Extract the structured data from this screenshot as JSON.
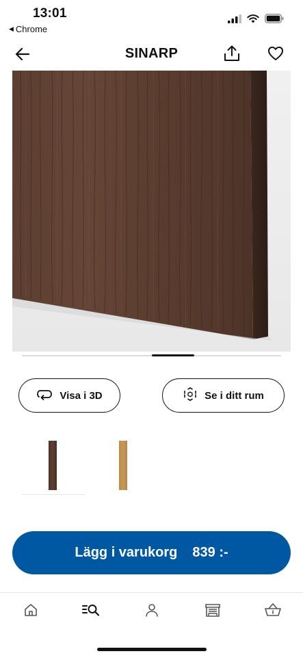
{
  "status_bar": {
    "time": "13:01",
    "back_app": "Chrome",
    "icons": [
      "signal-icon",
      "wifi-icon",
      "battery-icon"
    ]
  },
  "nav": {
    "title": "SINARP",
    "icons": [
      "back-arrow-icon",
      "share-icon",
      "heart-icon"
    ]
  },
  "product_image": {
    "description_color": "#5a3e30"
  },
  "actions": {
    "view_3d_label": "Visa i 3D",
    "view_in_room_label": "Se i ditt rum"
  },
  "swatches": [
    {
      "name": "dark-brown",
      "color": "#553a2c",
      "selected": true
    },
    {
      "name": "oak",
      "color": "#c1924f",
      "selected": false
    }
  ],
  "cart": {
    "label": "Lägg i varukorg",
    "price": "839 :-",
    "color": "#0058a3"
  },
  "tab_bar": {
    "items": [
      "home-icon",
      "search-icon",
      "profile-icon",
      "store-icon",
      "basket-icon"
    ]
  }
}
